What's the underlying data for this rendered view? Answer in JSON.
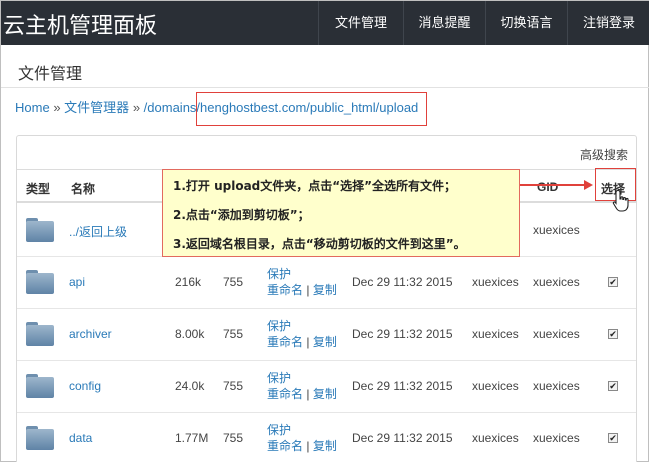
{
  "header": {
    "brand": "云主机管理面板",
    "nav": [
      "文件管理",
      "消息提醒",
      "切换语言",
      "注销登录"
    ]
  },
  "page": {
    "title": "文件管理"
  },
  "breadcrumb": {
    "home": "Home",
    "sep": "»",
    "file_manager": "文件管理器",
    "path": "/domains/henghostbest.com/public_html/upload"
  },
  "panel": {
    "advanced_search": "高级搜索",
    "columns": {
      "type": "类型",
      "name": "名称",
      "gid": "GID",
      "select": "选择"
    },
    "parent_row": {
      "name": "../返回上级",
      "gid": "xuexices"
    },
    "rows": [
      {
        "name": "api",
        "size": "216k",
        "perm": "755",
        "protect": "保护",
        "rename": "重命名",
        "copy": "复制",
        "date": "Dec 29 11:32 2015",
        "uid": "xuexices",
        "gid": "xuexices",
        "checked": true
      },
      {
        "name": "archiver",
        "size": "8.00k",
        "perm": "755",
        "protect": "保护",
        "rename": "重命名",
        "copy": "复制",
        "date": "Dec 29 11:32 2015",
        "uid": "xuexices",
        "gid": "xuexices",
        "checked": true
      },
      {
        "name": "config",
        "size": "24.0k",
        "perm": "755",
        "protect": "保护",
        "rename": "重命名",
        "copy": "复制",
        "date": "Dec 29 11:32 2015",
        "uid": "xuexices",
        "gid": "xuexices",
        "checked": true
      },
      {
        "name": "data",
        "size": "1.77M",
        "perm": "755",
        "protect": "保护",
        "rename": "重命名",
        "copy": "复制",
        "date": "Dec 29 11:32 2015",
        "uid": "xuexices",
        "gid": "xuexices",
        "checked": true
      }
    ]
  },
  "callout": {
    "step1": "1.打开 upload文件夹，点击“选择”全选所有文件；",
    "step2": "2.点击“添加到剪切板”；",
    "step3": "3.返回域名根目录，点击“移动剪切板的文件到这里”。"
  },
  "icons": {
    "folder": "folder-icon",
    "cursor": "hand-pointer-icon",
    "check": "checkbox-checked-icon"
  },
  "colors": {
    "topbar": "#2a2f36",
    "link": "#2a7ab8",
    "annotation": "#e0413b",
    "callout_bg": "#ffffcc"
  }
}
